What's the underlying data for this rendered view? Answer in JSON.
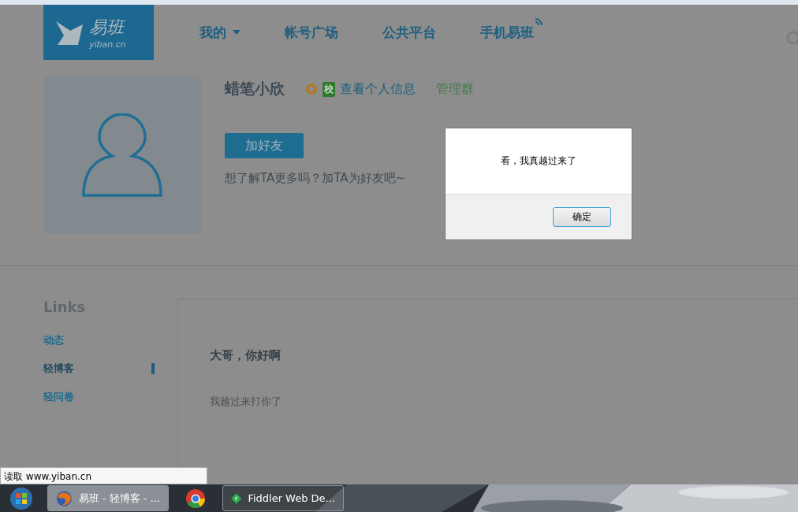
{
  "header": {
    "logo": {
      "name": "易班",
      "domain": "yiban.cn"
    },
    "nav": [
      {
        "label": "我的",
        "kind": "dropdown"
      },
      {
        "label": "帐号广场",
        "kind": "plain"
      },
      {
        "label": "公共平台",
        "kind": "plain"
      },
      {
        "label": "手机易班",
        "kind": "signal"
      }
    ]
  },
  "profile": {
    "name": "蜡笔小欣",
    "badge": "校",
    "info_link": "查看个人信息",
    "manage_link": "管理群",
    "add_button": "加好友",
    "hint": "想了解TA更多吗？加TA为好友吧~"
  },
  "sidebar": {
    "title": "Links",
    "items": [
      {
        "label": "动态",
        "selected": false
      },
      {
        "label": "轻博客",
        "selected": true
      },
      {
        "label": "轻问卷",
        "selected": false
      }
    ]
  },
  "post": {
    "title": "大哥，你好啊",
    "body": "我越过来打你了"
  },
  "dialog": {
    "message": "看，我真越过来了",
    "button": "确定"
  },
  "status_bar": "读取 www.yiban.cn",
  "taskbar": [
    {
      "label": "易班 - 轻博客 - ...",
      "kind": "firefox",
      "selected": true
    },
    {
      "kind": "chrome",
      "selected": false
    },
    {
      "label": "Fiddler Web De...",
      "kind": "fiddler",
      "selected": false
    }
  ]
}
